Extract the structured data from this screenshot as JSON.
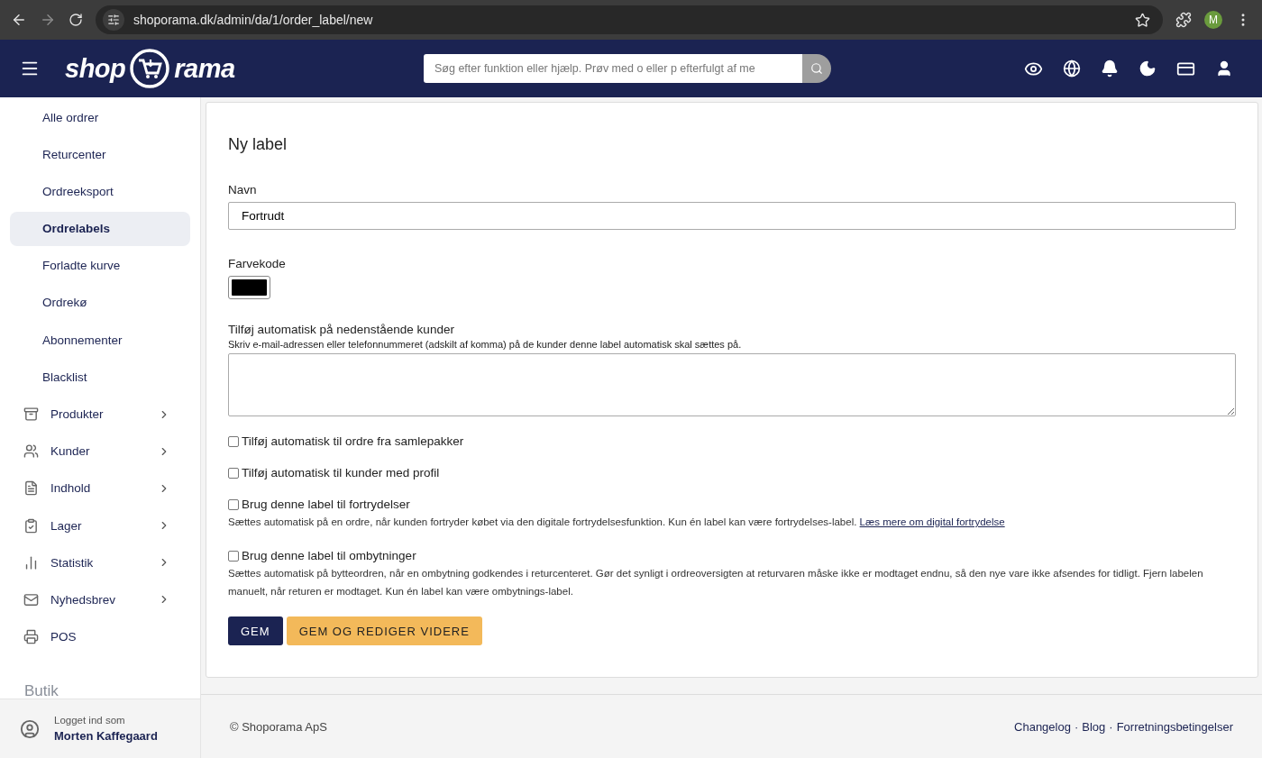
{
  "browser": {
    "url": "shoporama.dk/admin/da/1/order_label/new",
    "profile_initial": "M"
  },
  "header": {
    "logo": {
      "left": "shop",
      "right": "rama"
    },
    "search": {
      "placeholder": "Søg efter funktion eller hjælp. Prøv med o eller p efterfulgt af me"
    }
  },
  "sidebar": {
    "items": [
      {
        "label": "Alle ordrer",
        "kind": "subitem",
        "selected": false
      },
      {
        "label": "Returcenter",
        "kind": "subitem",
        "selected": false
      },
      {
        "label": "Ordreeksport",
        "kind": "subitem",
        "selected": false
      },
      {
        "label": "Ordrelabels",
        "kind": "subitem",
        "selected": true
      },
      {
        "label": "Forladte kurve",
        "kind": "subitem",
        "selected": false
      },
      {
        "label": "Ordrekø",
        "kind": "subitem",
        "selected": false
      },
      {
        "label": "Abonnementer",
        "kind": "subitem",
        "selected": false
      },
      {
        "label": "Blacklist",
        "kind": "subitem",
        "selected": false
      },
      {
        "label": "Produkter",
        "kind": "group",
        "selected": false
      },
      {
        "label": "Kunder",
        "kind": "group",
        "selected": false
      },
      {
        "label": "Indhold",
        "kind": "group",
        "selected": false
      },
      {
        "label": "Lager",
        "kind": "group",
        "selected": false
      },
      {
        "label": "Statistik",
        "kind": "group",
        "selected": false
      },
      {
        "label": "Nyhedsbrev",
        "kind": "group",
        "selected": false
      },
      {
        "label": "POS",
        "kind": "link",
        "selected": false
      }
    ],
    "section_heading": "Butik",
    "user": {
      "caption": "Logget ind som",
      "name": "Morten Kaffegaard"
    }
  },
  "form": {
    "title": "Ny label",
    "name_field": {
      "label": "Navn",
      "value": "Fortrudt"
    },
    "color_field": {
      "label": "Farvekode",
      "color": "#000000"
    },
    "customers_field": {
      "label": "Tilføj automatisk på nedenstående kunder",
      "help": "Skriv e-mail-adressen eller telefonnummeret (adskilt af komma) på de kunder denne label automatisk skal sættes på."
    },
    "checkboxes": [
      {
        "label": "Tilføj automatisk til ordre fra samlepakker",
        "checked": false
      },
      {
        "label": "Tilføj automatisk til kunder med profil",
        "checked": false
      },
      {
        "label": "Brug denne label til fortrydelser",
        "checked": false,
        "description": "Sættes automatisk på en ordre, når kunden fortryder købet via den digitale fortrydelsesfunktion. Kun én label kan være fortrydelses-label.",
        "link": "Læs mere om digital fortrydelse"
      },
      {
        "label": "Brug denne label til ombytninger",
        "checked": false,
        "description": "Sættes automatisk på bytteordren, når en ombytning godkendes i returcenteret. Gør det synligt i ordreoversigten at returvaren måske ikke er modtaget endnu, så den nye vare ikke afsendes for tidligt. Fjern labelen manuelt, når returen er modtaget. Kun én label kan være ombytnings-label."
      }
    ],
    "buttons": [
      {
        "label": "GEM",
        "kind": "primary"
      },
      {
        "label": "GEM OG REDIGER VIDERE",
        "kind": "secondary"
      }
    ]
  },
  "footer": {
    "copyright": "© Shoporama ApS",
    "links": [
      "Changelog",
      "Blog",
      "Forretningsbetingelser"
    ],
    "separator": "·"
  }
}
